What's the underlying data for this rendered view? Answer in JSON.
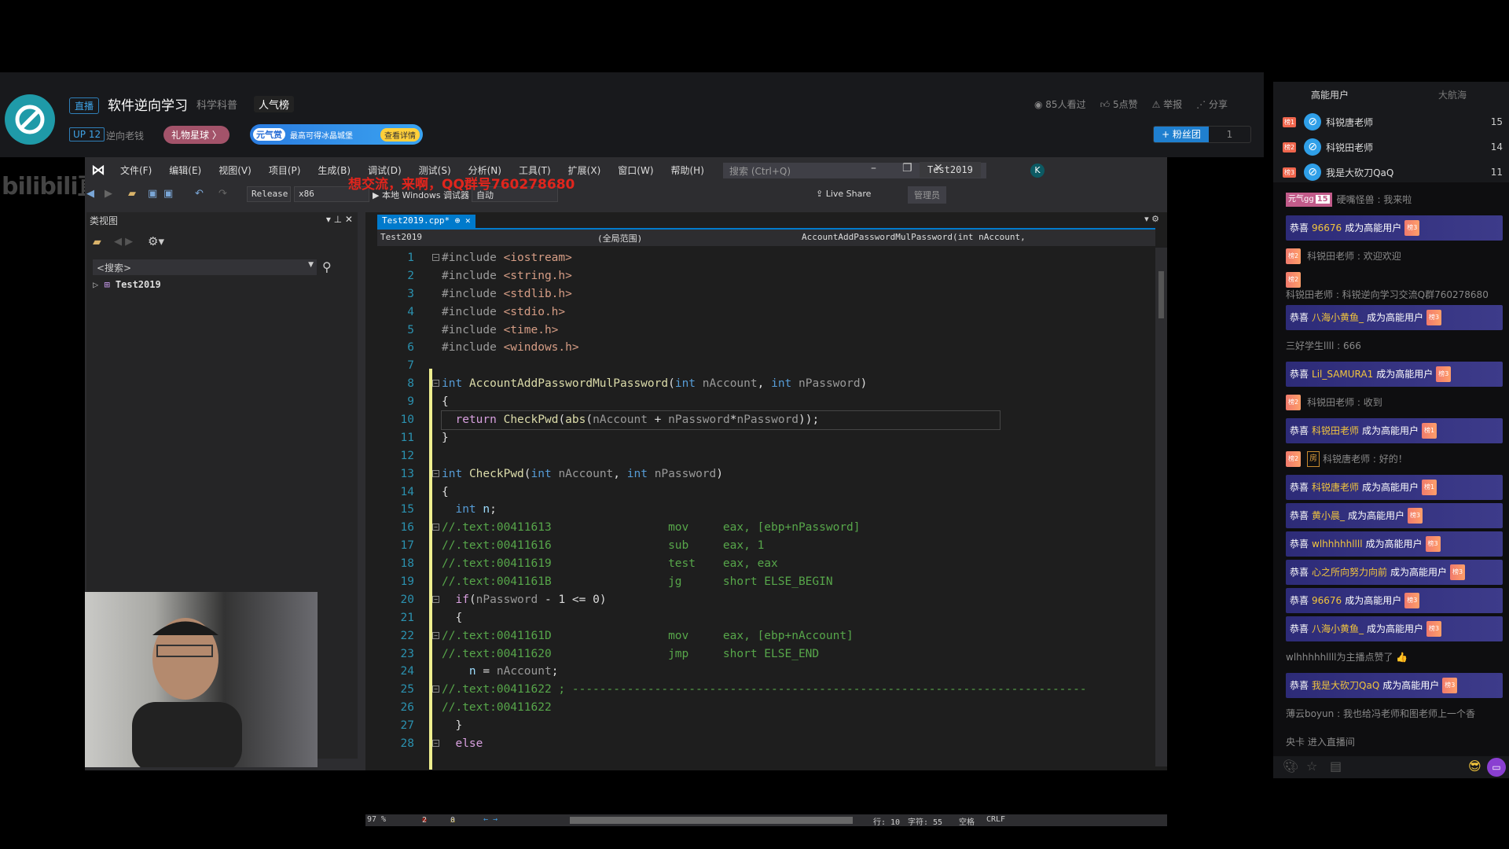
{
  "header": {
    "live_badge": "直播",
    "title": "软件逆向学习",
    "category": "科学科普",
    "popularity": "人气榜",
    "up_level": "UP 12",
    "anchor": "逆向老钱",
    "gift_planet": "礼物星球 〉",
    "banner_tag": "元气赏",
    "banner_text": "最高可得冰晶城堡",
    "banner_button": "查看详情",
    "views": "85人看过",
    "likes": "5点赞",
    "report": "举报",
    "share": "分享",
    "fan_club": "+ 粉丝团",
    "fan_count": "1"
  },
  "watermark": "bilibili直播",
  "overlay_text": "想交流，来啊，QQ群号760278680",
  "ide": {
    "menu": [
      "文件(F)",
      "编辑(E)",
      "视图(V)",
      "项目(P)",
      "生成(B)",
      "调试(D)",
      "测试(S)",
      "分析(N)",
      "工具(T)",
      "扩展(X)",
      "窗口(W)",
      "帮助(H)"
    ],
    "search_placeholder": "搜索 (Ctrl+Q)",
    "solution_title": "Test2019",
    "account_initial": "K",
    "config": "Release",
    "platform": "x86",
    "debugger": "▶ 本地 Windows 调试器",
    "auto": "自动",
    "live_share": "Live Share",
    "admin": "管理员",
    "class_view": {
      "title": "类视图",
      "search": "<搜索>",
      "tree_item": "Test2019"
    },
    "tab": "Test2019.cpp*  ⊕  ✕",
    "nav": {
      "project": "Test2019",
      "scope": "(全局范围)",
      "member": "AccountAddPasswordMulPassword(int nAccount,"
    },
    "current_line": 10,
    "code": [
      {
        "n": 1,
        "fold": true,
        "s": [
          [
            "#include",
            "pp"
          ],
          [
            " ",
            "txt0"
          ],
          [
            "<iostream>",
            "inc"
          ]
        ]
      },
      {
        "n": 2,
        "s": [
          [
            "#include",
            "pp"
          ],
          [
            " ",
            "txt0"
          ],
          [
            "<string.h>",
            "inc"
          ]
        ]
      },
      {
        "n": 3,
        "s": [
          [
            "#include",
            "pp"
          ],
          [
            " ",
            "txt0"
          ],
          [
            "<stdlib.h>",
            "inc"
          ]
        ]
      },
      {
        "n": 4,
        "s": [
          [
            "#include",
            "pp"
          ],
          [
            " ",
            "txt0"
          ],
          [
            "<stdio.h>",
            "inc"
          ]
        ]
      },
      {
        "n": 5,
        "s": [
          [
            "#include",
            "pp"
          ],
          [
            " ",
            "txt0"
          ],
          [
            "<time.h>",
            "inc"
          ]
        ]
      },
      {
        "n": 6,
        "s": [
          [
            "#include",
            "pp"
          ],
          [
            " ",
            "txt0"
          ],
          [
            "<windows.h>",
            "inc"
          ]
        ]
      },
      {
        "n": 7,
        "s": []
      },
      {
        "n": 8,
        "fold": true,
        "s": [
          [
            "int",
            "kw"
          ],
          [
            " ",
            "txt0"
          ],
          [
            "AccountAddPasswordMulPassword",
            "fn"
          ],
          [
            "(",
            "txt0"
          ],
          [
            "int",
            "kw"
          ],
          [
            " ",
            "txt0"
          ],
          [
            "nAccount",
            "param"
          ],
          [
            ", ",
            "txt0"
          ],
          [
            "int",
            "kw"
          ],
          [
            " ",
            "txt0"
          ],
          [
            "nPassword",
            "param"
          ],
          [
            ")",
            "txt0"
          ]
        ]
      },
      {
        "n": 9,
        "s": [
          [
            "{",
            "txt0"
          ]
        ]
      },
      {
        "n": 10,
        "s": [
          [
            "  ",
            "txt0"
          ],
          [
            "return",
            "ctl"
          ],
          [
            " ",
            "txt0"
          ],
          [
            "CheckPwd",
            "fn"
          ],
          [
            "(",
            "txt0"
          ],
          [
            "abs",
            "fn"
          ],
          [
            "(",
            "txt0"
          ],
          [
            "nAccount",
            "param"
          ],
          [
            " + ",
            "txt0"
          ],
          [
            "nPassword",
            "param"
          ],
          [
            "*",
            "txt0"
          ],
          [
            "nPassword",
            "param"
          ],
          [
            "));",
            "txt0"
          ]
        ]
      },
      {
        "n": 11,
        "s": [
          [
            "}",
            "txt0"
          ]
        ]
      },
      {
        "n": 12,
        "s": []
      },
      {
        "n": 13,
        "fold": true,
        "s": [
          [
            "int",
            "kw"
          ],
          [
            " ",
            "txt0"
          ],
          [
            "CheckPwd",
            "fn"
          ],
          [
            "(",
            "txt0"
          ],
          [
            "int",
            "kw"
          ],
          [
            " ",
            "txt0"
          ],
          [
            "nAccount",
            "param"
          ],
          [
            ", ",
            "txt0"
          ],
          [
            "int",
            "kw"
          ],
          [
            " ",
            "txt0"
          ],
          [
            "nPassword",
            "param"
          ],
          [
            ")",
            "txt0"
          ]
        ]
      },
      {
        "n": 14,
        "s": [
          [
            "{",
            "txt0"
          ]
        ]
      },
      {
        "n": 15,
        "s": [
          [
            "  ",
            "txt0"
          ],
          [
            "int",
            "kw"
          ],
          [
            " ",
            "txt0"
          ],
          [
            "n",
            "var"
          ],
          [
            ";",
            "txt0"
          ]
        ]
      },
      {
        "n": 16,
        "fold": true,
        "s": [
          [
            "//.text:00411613                 mov     eax, [ebp+nPassword]",
            "cm"
          ]
        ]
      },
      {
        "n": 17,
        "s": [
          [
            "//.text:00411616                 sub     eax, 1",
            "cm"
          ]
        ]
      },
      {
        "n": 18,
        "s": [
          [
            "//.text:00411619                 test    eax, eax",
            "cm"
          ]
        ]
      },
      {
        "n": 19,
        "s": [
          [
            "//.text:0041161B                 jg      short ELSE_BEGIN",
            "cm"
          ]
        ]
      },
      {
        "n": 20,
        "fold": true,
        "s": [
          [
            "  ",
            "txt0"
          ],
          [
            "if",
            "ctl"
          ],
          [
            "(",
            "txt0"
          ],
          [
            "nPassword",
            "param"
          ],
          [
            " - 1 <= 0)",
            "txt0"
          ]
        ]
      },
      {
        "n": 21,
        "s": [
          [
            "  {",
            "txt0"
          ]
        ]
      },
      {
        "n": 22,
        "fold": true,
        "s": [
          [
            "//.text:0041161D                 mov     eax, [ebp+nAccount]",
            "cm"
          ]
        ]
      },
      {
        "n": 23,
        "s": [
          [
            "//.text:00411620                 jmp     short ELSE_END",
            "cm"
          ]
        ]
      },
      {
        "n": 24,
        "s": [
          [
            "    ",
            "txt0"
          ],
          [
            "n",
            "var"
          ],
          [
            " = ",
            "txt0"
          ],
          [
            "nAccount",
            "param"
          ],
          [
            ";",
            "txt0"
          ]
        ]
      },
      {
        "n": 25,
        "fold": true,
        "s": [
          [
            "//.text:00411622 ; ---------------------------------------------------------------------------",
            "cm"
          ]
        ]
      },
      {
        "n": 26,
        "s": [
          [
            "//.text:00411622",
            "cm"
          ]
        ]
      },
      {
        "n": 27,
        "s": [
          [
            "  }",
            "txt0"
          ]
        ]
      },
      {
        "n": 28,
        "fold": true,
        "s": [
          [
            "  ",
            "txt0"
          ],
          [
            "else",
            "ctl"
          ]
        ]
      }
    ],
    "status": {
      "zoom": "97 %",
      "errors": "2",
      "warnings": "0",
      "line": "行: 10",
      "char": "字符: 55",
      "spaces": "空格",
      "eol": "CRLF"
    }
  },
  "side": {
    "tabs": [
      "高能用户",
      "大航海"
    ],
    "ranks": [
      {
        "badge": "榜1",
        "name": "科锐唐老师",
        "score": "15"
      },
      {
        "badge": "榜2",
        "name": "科锐田老师",
        "score": "14"
      },
      {
        "badge": "榜3",
        "name": "我是大砍刀QaQ",
        "score": "11"
      }
    ],
    "chat": [
      {
        "type": "msg",
        "medal": "元气gg",
        "medal_lv": "15",
        "text": "硬嘴怪兽 : 我来啦"
      },
      {
        "type": "banner",
        "pre": "恭喜",
        "user": "96676",
        "post": "成为高能用户",
        "lvl": "榜3"
      },
      {
        "type": "msg",
        "lvl": "榜2",
        "text": "科锐田老师 : 欢迎欢迎"
      },
      {
        "type": "msg",
        "lvl": "榜2",
        "text": "科锐田老师 : 科锐逆向学习交流Q群760278680"
      },
      {
        "type": "banner",
        "pre": "恭喜",
        "user": "八海小黄鱼_",
        "post": "成为高能用户",
        "lvl": "榜3"
      },
      {
        "type": "msg",
        "text": "三好学生llll : 666"
      },
      {
        "type": "banner",
        "pre": "恭喜",
        "user": "Lil_SAMURA1",
        "post": "成为高能用户",
        "lvl": "榜3"
      },
      {
        "type": "msg",
        "lvl": "榜2",
        "text": "科锐田老师 : 收到"
      },
      {
        "type": "banner",
        "pre": "恭喜",
        "user": "科锐田老师",
        "post": "成为高能用户",
        "lvl": "榜1"
      },
      {
        "type": "msg",
        "lvl": "榜2",
        "room": "房",
        "text": "科锐唐老师 : 好的！"
      },
      {
        "type": "banner",
        "pre": "恭喜",
        "user": "科锐唐老师",
        "post": "成为高能用户",
        "lvl": "榜1"
      },
      {
        "type": "banner",
        "pre": "恭喜",
        "user": "黄小晨_",
        "post": "成为高能用户",
        "lvl": "榜3"
      },
      {
        "type": "banner",
        "pre": "恭喜",
        "user": "wlhhhhhllll",
        "post": "成为高能用户",
        "lvl": "榜3"
      },
      {
        "type": "banner",
        "pre": "恭喜",
        "user": "心之所向努力向前",
        "post": "成为高能用户",
        "lvl": "榜3"
      },
      {
        "type": "banner",
        "pre": "恭喜",
        "user": "96676",
        "post": "成为高能用户",
        "lvl": "榜3"
      },
      {
        "type": "banner",
        "pre": "恭喜",
        "user": "八海小黄鱼_",
        "post": "成为高能用户",
        "lvl": "榜3"
      },
      {
        "type": "msg",
        "text": "wlhhhhhllll为主播点赞了 👍"
      },
      {
        "type": "banner",
        "pre": "恭喜",
        "user": "我是大砍刀QaQ",
        "post": "成为高能用户",
        "lvl": "榜3"
      },
      {
        "type": "msg",
        "text": "薄云boyun : 我也给冯老师和图老师上一个香"
      },
      {
        "type": "msg",
        "text": "央卡 进入直播间"
      }
    ]
  }
}
